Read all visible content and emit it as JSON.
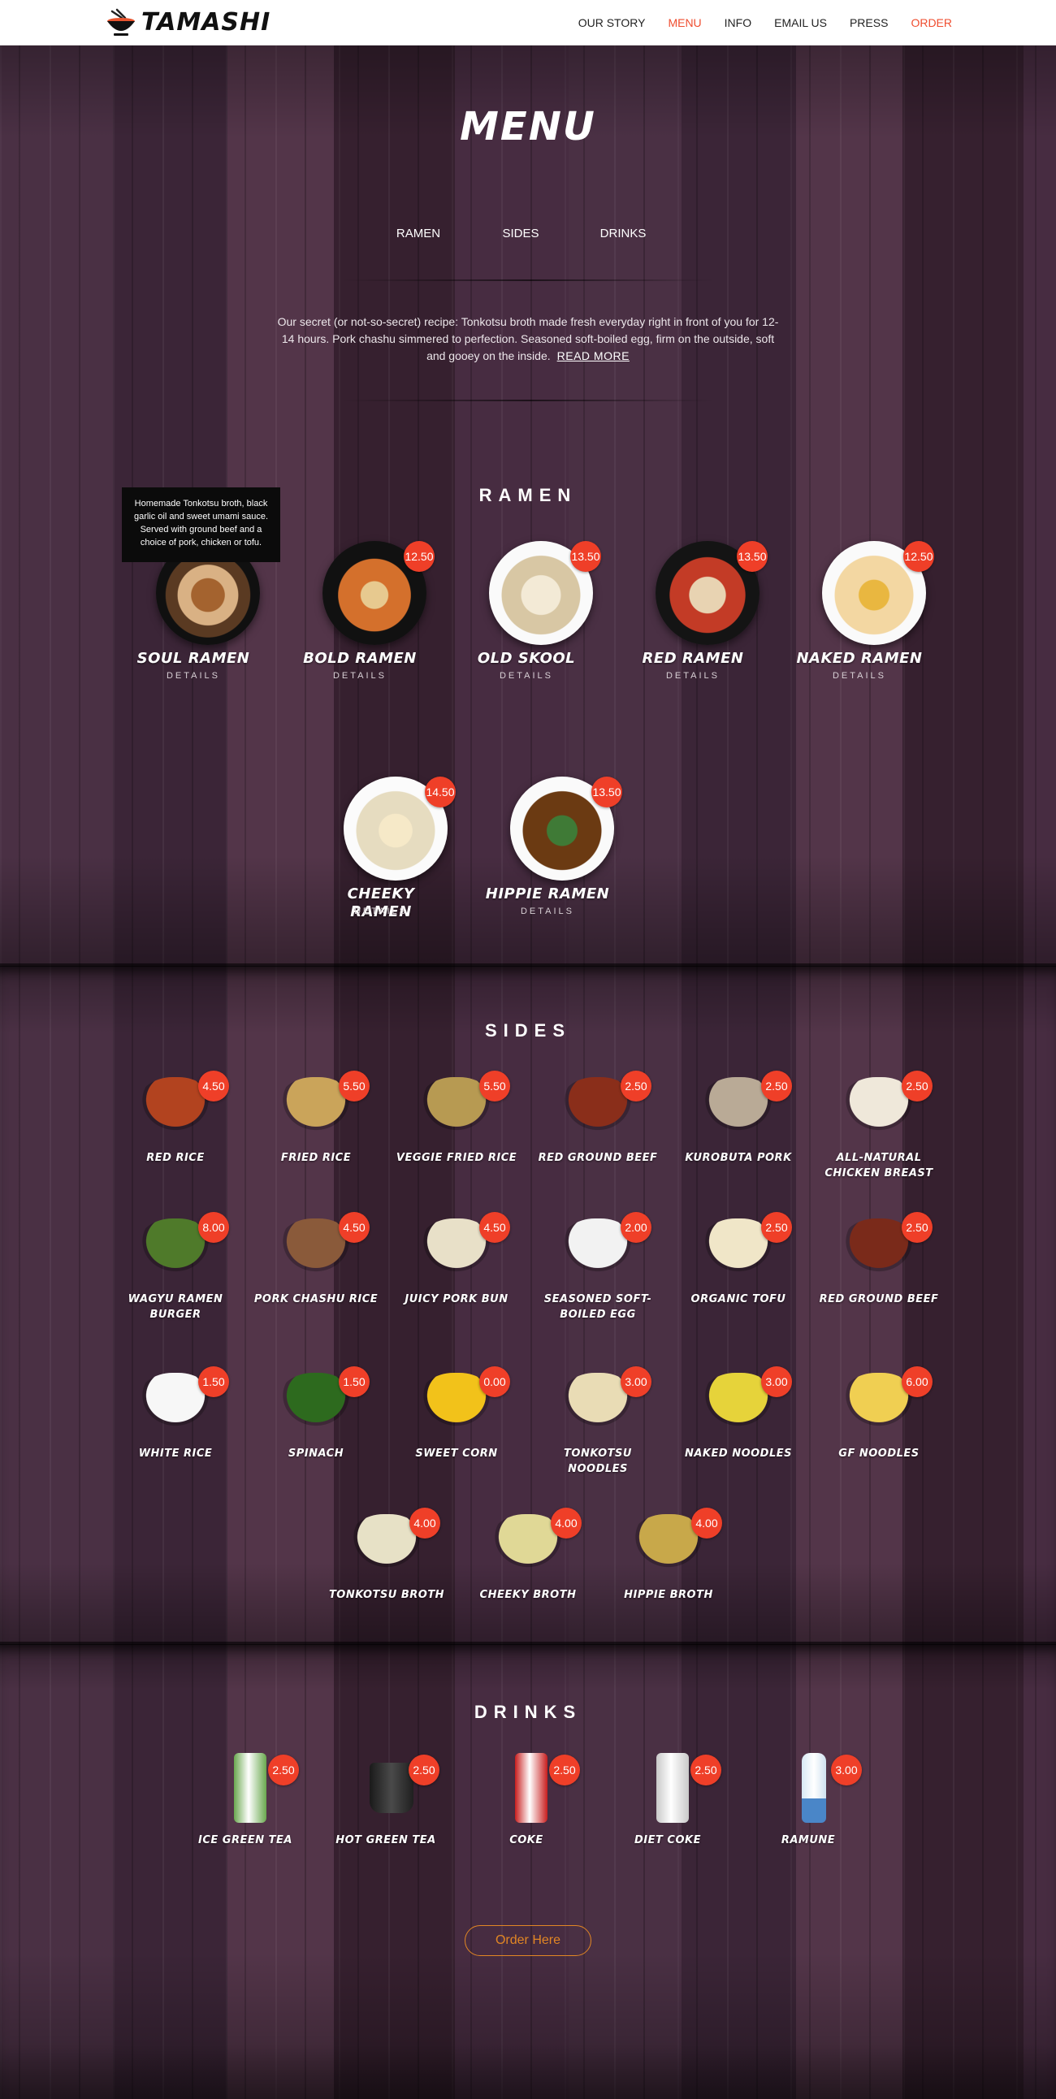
{
  "header": {
    "logo_text": "TAMASHI",
    "nav": [
      "OUR STORY",
      "MENU",
      "INFO",
      "EMAIL US",
      "PRESS",
      "ORDER"
    ]
  },
  "hero": {
    "title": "MENU",
    "tabs": [
      "RAMEN",
      "SIDES",
      "DRINKS"
    ],
    "intro": "Our secret (or not-so-secret) recipe: Tonkotsu broth made fresh everyday right in front of you for 12-14 hours. Pork chashu simmered to perfection. Seasoned soft-boiled egg, firm on the outside, soft and gooey on the inside.",
    "read_more": "READ MORE"
  },
  "ramen": {
    "title": "RAMEN",
    "details_label": "DETAILS",
    "tooltip": "Homemade Tonkotsu broth, black garlic oil and sweet umami sauce. Served with ground beef and a choice of pork, chicken or tofu.",
    "items": [
      {
        "name": "SOUL RAMEN",
        "price": ""
      },
      {
        "name": "BOLD RAMEN",
        "price": "12.50"
      },
      {
        "name": "OLD SKOOL",
        "price": "13.50"
      },
      {
        "name": "RED RAMEN",
        "price": "13.50"
      },
      {
        "name": "NAKED RAMEN",
        "price": "12.50"
      },
      {
        "name": "CHEEKY RAMEN",
        "price": "14.50"
      },
      {
        "name": "HIPPIE RAMEN",
        "price": "13.50"
      }
    ]
  },
  "sides": {
    "title": "SIDES",
    "items": [
      {
        "name": "RED RICE",
        "price": "4.50"
      },
      {
        "name": "FRIED RICE",
        "price": "5.50"
      },
      {
        "name": "VEGGIE FRIED RICE",
        "price": "5.50"
      },
      {
        "name": "RED GROUND BEEF",
        "price": "2.50"
      },
      {
        "name": "KUROBUTA PORK",
        "price": "2.50"
      },
      {
        "name": "ALL-NATURAL CHICKEN BREAST",
        "price": "2.50"
      },
      {
        "name": "WAGYU RAMEN BURGER",
        "price": "8.00"
      },
      {
        "name": "PORK CHASHU RICE",
        "price": "4.50"
      },
      {
        "name": "JUICY PORK BUN",
        "price": "4.50"
      },
      {
        "name": "SEASONED SOFT-BOILED EGG",
        "price": "2.00"
      },
      {
        "name": "ORGANIC TOFU",
        "price": "2.50"
      },
      {
        "name": "RED GROUND BEEF",
        "price": "2.50"
      },
      {
        "name": "WHITE RICE",
        "price": "1.50"
      },
      {
        "name": "SPINACH",
        "price": "1.50"
      },
      {
        "name": "SWEET CORN",
        "price": "0.00"
      },
      {
        "name": "TONKOTSU NOODLES",
        "price": "3.00"
      },
      {
        "name": "NAKED NOODLES",
        "price": "3.00"
      },
      {
        "name": "GF NOODLES",
        "price": "6.00"
      },
      {
        "name": "TONKOTSU BROTH",
        "price": "4.00"
      },
      {
        "name": "CHEEKY BROTH",
        "price": "4.00"
      },
      {
        "name": "HIPPIE BROTH",
        "price": "4.00"
      }
    ]
  },
  "drinks": {
    "title": "DRINKS",
    "items": [
      {
        "name": "ICE GREEN TEA",
        "price": "2.50"
      },
      {
        "name": "HOT GREEN TEA",
        "price": "2.50"
      },
      {
        "name": "COKE",
        "price": "2.50"
      },
      {
        "name": "DIET COKE",
        "price": "2.50"
      },
      {
        "name": "RAMUNE",
        "price": "3.00"
      }
    ]
  },
  "order_button": "Order Here",
  "colors": {
    "accent": "#ef4d2f",
    "price_badge": "#ef3f28",
    "order_button": "#e28624"
  }
}
